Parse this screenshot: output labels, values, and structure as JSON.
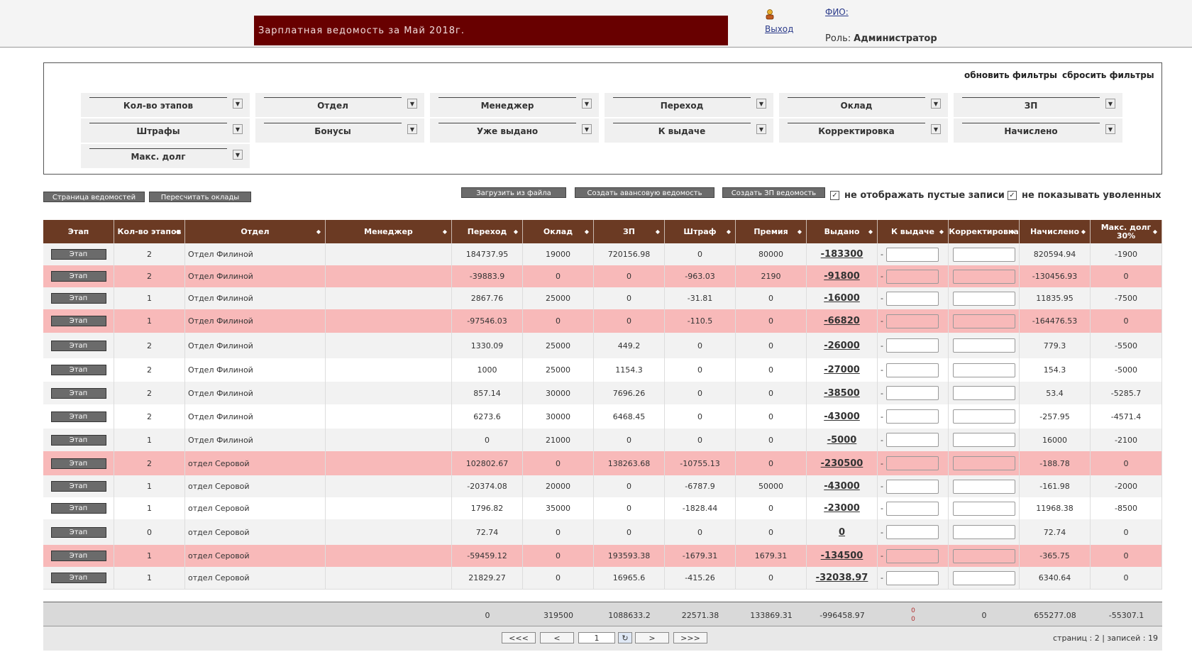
{
  "header": {
    "title": "Зарплатная ведомость за Май 2018г.",
    "logout": "Выход",
    "fio_label": "ФИО:",
    "role_label": "Роль:",
    "role_value": "Администратор"
  },
  "filters": {
    "refresh": "обновить фильтры",
    "reset": "сбросить фильтры",
    "items": [
      "Кол-во этапов",
      "Отдел",
      "Менеджер",
      "Переход",
      "Оклад",
      "ЗП",
      "Штрафы",
      "Бонусы",
      "Уже выдано",
      "К выдаче",
      "Корректировка",
      "Начислено",
      "Макс. долг"
    ]
  },
  "toolbar": {
    "pages": "Страница ведомостей",
    "recalc": "Пересчитать оклады",
    "upload": "Загрузить из файла",
    "advance": "Создать авансовую ведомость",
    "create_zp": "Создать ЗП ведомость",
    "hide_empty": "не отображать пустые записи",
    "hide_fired": "не показывать уволенных"
  },
  "table": {
    "columns": [
      "Этап",
      "Кол-во этапов",
      "Отдел",
      "Менеджер",
      "Переход",
      "Оклад",
      "ЗП",
      "Штраф",
      "Премия",
      "Выдано",
      "К выдаче",
      "Корректировка",
      "Начислено",
      "Макс. долг 30%"
    ],
    "stage_btn": "Этап",
    "rows": [
      {
        "n": "2",
        "dept": "Отдел Филиной",
        "mgr": "",
        "trans": "184737.95",
        "salary": "19000",
        "zp": "720156.98",
        "fine": "0",
        "bonus": "80000",
        "issued": "-183300",
        "accr": "820594.94",
        "debt": "-1900",
        "style": "norm"
      },
      {
        "n": "2",
        "dept": "Отдел Филиной",
        "mgr": "",
        "trans": "-39883.9",
        "salary": "0",
        "zp": "0",
        "fine": "-963.03",
        "bonus": "2190",
        "issued": "-91800",
        "accr": "-130456.93",
        "debt": "0",
        "style": "pink"
      },
      {
        "n": "1",
        "dept": "Отдел Филиной",
        "mgr": "",
        "trans": "2867.76",
        "salary": "25000",
        "zp": "0",
        "fine": "-31.81",
        "bonus": "0",
        "issued": "-16000",
        "accr": "11835.95",
        "debt": "-7500",
        "style": "norm"
      },
      {
        "n": "1",
        "dept": "Отдел Филиной",
        "mgr": "",
        "trans": "-97546.03",
        "salary": "0",
        "zp": "0",
        "fine": "-110.5",
        "bonus": "0",
        "issued": "-66820",
        "accr": "-164476.53",
        "debt": "0",
        "style": "pink"
      },
      {
        "n": "2",
        "dept": "Отдел Филиной",
        "mgr": "",
        "trans": "1330.09",
        "salary": "25000",
        "zp": "449.2",
        "fine": "0",
        "bonus": "0",
        "issued": "-26000",
        "accr": "779.3",
        "debt": "-5500",
        "style": "norm"
      },
      {
        "n": "2",
        "dept": "Отдел Филиной",
        "mgr": "",
        "trans": "1000",
        "salary": "25000",
        "zp": "1154.3",
        "fine": "0",
        "bonus": "0",
        "issued": "-27000",
        "accr": "154.3",
        "debt": "-5000",
        "style": "alt"
      },
      {
        "n": "2",
        "dept": "Отдел Филиной",
        "mgr": "",
        "trans": "857.14",
        "salary": "30000",
        "zp": "7696.26",
        "fine": "0",
        "bonus": "0",
        "issued": "-38500",
        "accr": "53.4",
        "debt": "-5285.7",
        "style": "norm"
      },
      {
        "n": "2",
        "dept": "Отдел Филиной",
        "mgr": "",
        "trans": "6273.6",
        "salary": "30000",
        "zp": "6468.45",
        "fine": "0",
        "bonus": "0",
        "issued": "-43000",
        "accr": "-257.95",
        "debt": "-4571.4",
        "style": "alt"
      },
      {
        "n": "1",
        "dept": "Отдел Филиной",
        "mgr": "",
        "trans": "0",
        "salary": "21000",
        "zp": "0",
        "fine": "0",
        "bonus": "0",
        "issued": "-5000",
        "accr": "16000",
        "debt": "-2100",
        "style": "norm"
      },
      {
        "n": "2",
        "dept": "отдел Серовой",
        "mgr": "",
        "trans": "102802.67",
        "salary": "0",
        "zp": "138263.68",
        "fine": "-10755.13",
        "bonus": "0",
        "issued": "-230500",
        "accr": "-188.78",
        "debt": "0",
        "style": "pink"
      },
      {
        "n": "1",
        "dept": "отдел Серовой",
        "mgr": "",
        "trans": "-20374.08",
        "salary": "20000",
        "zp": "0",
        "fine": "-6787.9",
        "bonus": "50000",
        "issued": "-43000",
        "accr": "-161.98",
        "debt": "-2000",
        "style": "norm"
      },
      {
        "n": "1",
        "dept": "отдел Серовой",
        "mgr": "",
        "trans": "1796.82",
        "salary": "35000",
        "zp": "0",
        "fine": "-1828.44",
        "bonus": "0",
        "issued": "-23000",
        "accr": "11968.38",
        "debt": "-8500",
        "style": "alt"
      },
      {
        "n": "0",
        "dept": "отдел Серовой",
        "mgr": "",
        "trans": "72.74",
        "salary": "0",
        "zp": "0",
        "fine": "0",
        "bonus": "0",
        "issued": "0",
        "accr": "72.74",
        "debt": "0",
        "style": "norm"
      },
      {
        "n": "1",
        "dept": "отдел Серовой",
        "mgr": "",
        "trans": "-59459.12",
        "salary": "0",
        "zp": "193593.38",
        "fine": "-1679.31",
        "bonus": "1679.31",
        "issued": "-134500",
        "accr": "-365.75",
        "debt": "0",
        "style": "pink"
      },
      {
        "n": "1",
        "dept": "отдел Серовой",
        "mgr": "",
        "trans": "21829.27",
        "salary": "0",
        "zp": "16965.6",
        "fine": "-415.26",
        "bonus": "0",
        "issued": "-32038.97",
        "accr": "6340.64",
        "debt": "0",
        "style": "norm"
      }
    ],
    "totals": {
      "trans": "0",
      "salary": "319500",
      "zp": "1088633.2",
      "fine": "22571.38",
      "bonus": "133869.31",
      "issued": "-996458.97",
      "topay_a": "0",
      "topay_b": "0",
      "corr": "0",
      "accr": "655277.08",
      "debt": "-55307.1"
    }
  },
  "pager": {
    "first": "<<<",
    "prev": "<",
    "page": "1",
    "next": ">",
    "last": ">>>",
    "info": "страниц : 2 | записей : 19"
  }
}
